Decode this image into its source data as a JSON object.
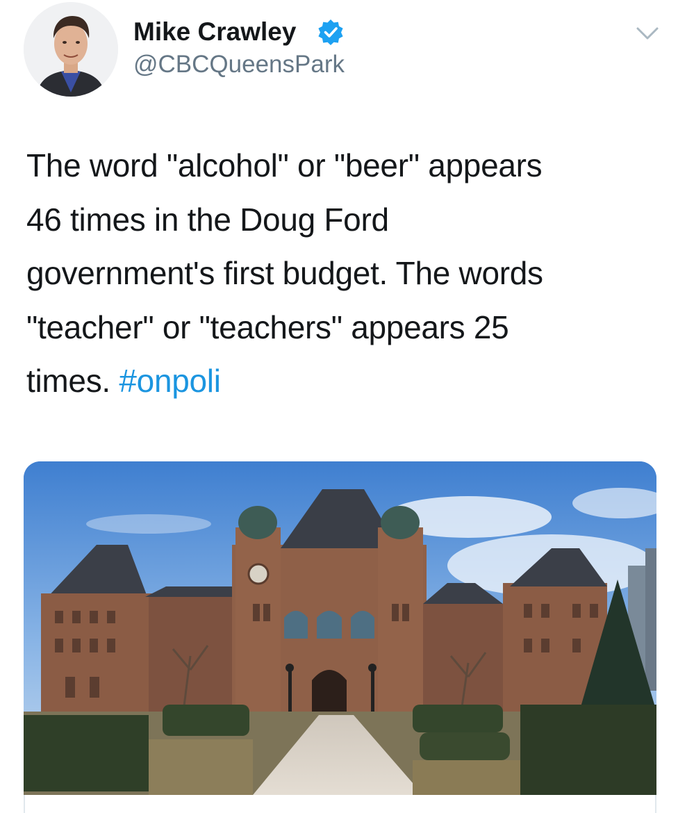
{
  "tweet": {
    "author": {
      "name": "Mike Crawley",
      "handle": "@CBCQueensPark",
      "verified": true,
      "avatar_icon": "profile-photo"
    },
    "text_lines": [
      "The word \"alcohol\" or \"beer\" appears",
      "46 times in the Doug Ford",
      "government's first budget. The words",
      "\"teacher\" or \"teachers\" appears 25",
      "times."
    ],
    "hashtag": "#onpoli",
    "media": {
      "icon": "photo-ontario-legislative-building"
    }
  },
  "colors": {
    "text": "#14171a",
    "secondary": "#657786",
    "link": "#1b95e0",
    "verified": "#1da1f2"
  }
}
